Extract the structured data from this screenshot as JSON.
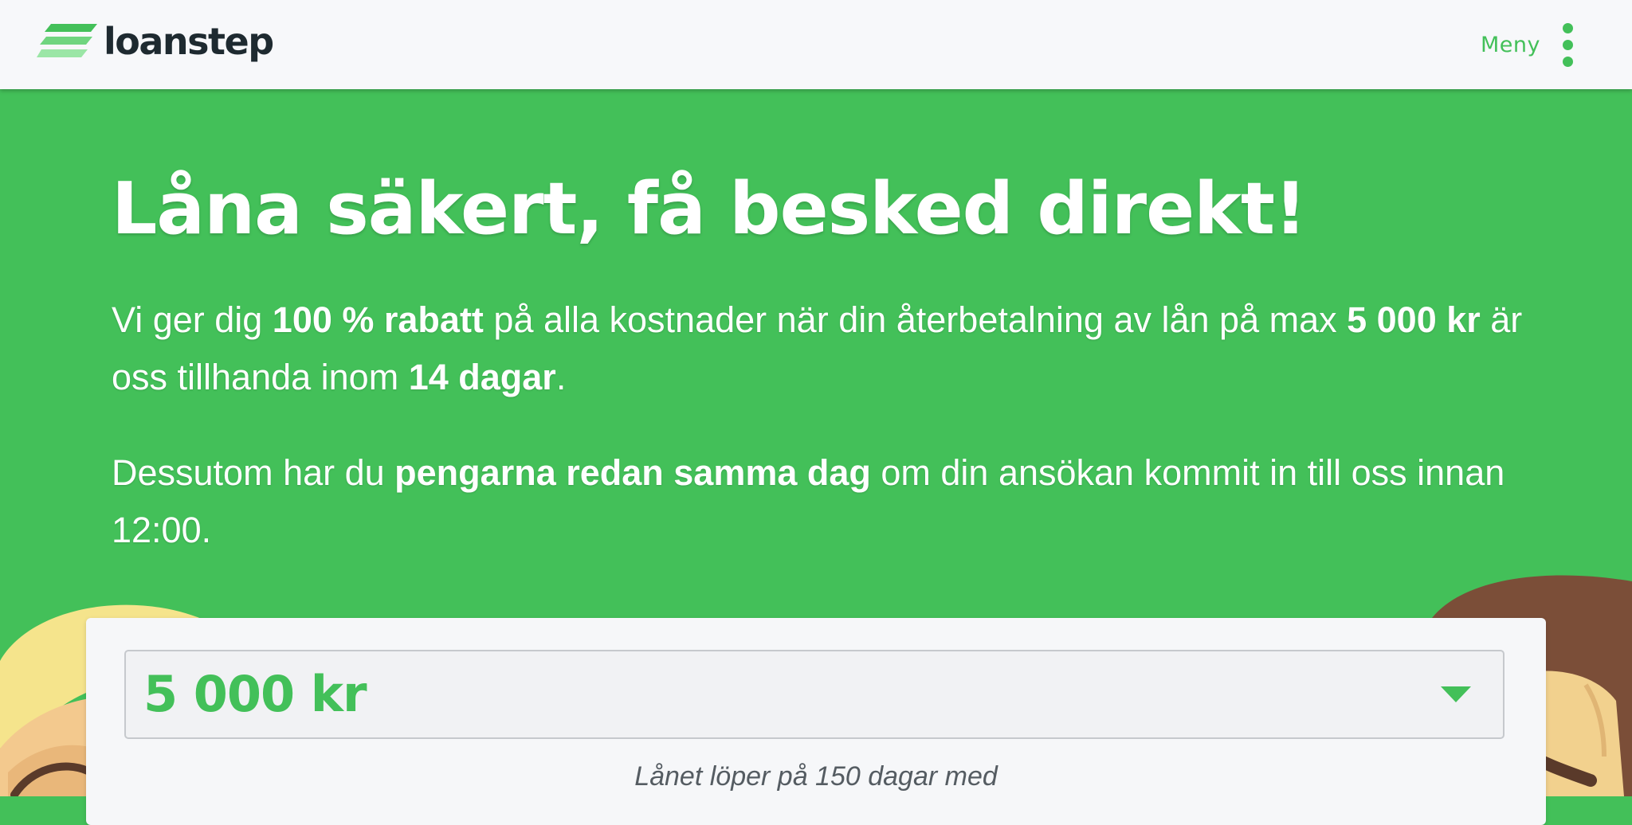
{
  "header": {
    "logo_text": "loanstep",
    "menu_label": "Meny",
    "menu_icon": "kebab-icon"
  },
  "hero": {
    "title": "Låna säkert, få besked direkt!",
    "p1": {
      "t1": "Vi ger dig ",
      "b1": "100 % rabatt",
      "t2": " på alla kostnader när din återbetalning av lån på max ",
      "b2": "5 000 kr",
      "t3": " är oss tillhanda inom ",
      "b3": "14 dagar",
      "t4": "."
    },
    "p2": {
      "t1": "Dessutom har du ",
      "b1": "pengarna redan samma dag",
      "t2": " om din ansökan kommit in till oss innan 12:00."
    }
  },
  "calculator": {
    "amount_value": "5 000 kr",
    "note": "Lånet löper på 150 dagar med"
  },
  "colors": {
    "brand_green": "#43c059",
    "header_bg": "#f7f8fa",
    "logo_dark": "#1e2a30",
    "logo_light_green": "#8ee39a"
  }
}
